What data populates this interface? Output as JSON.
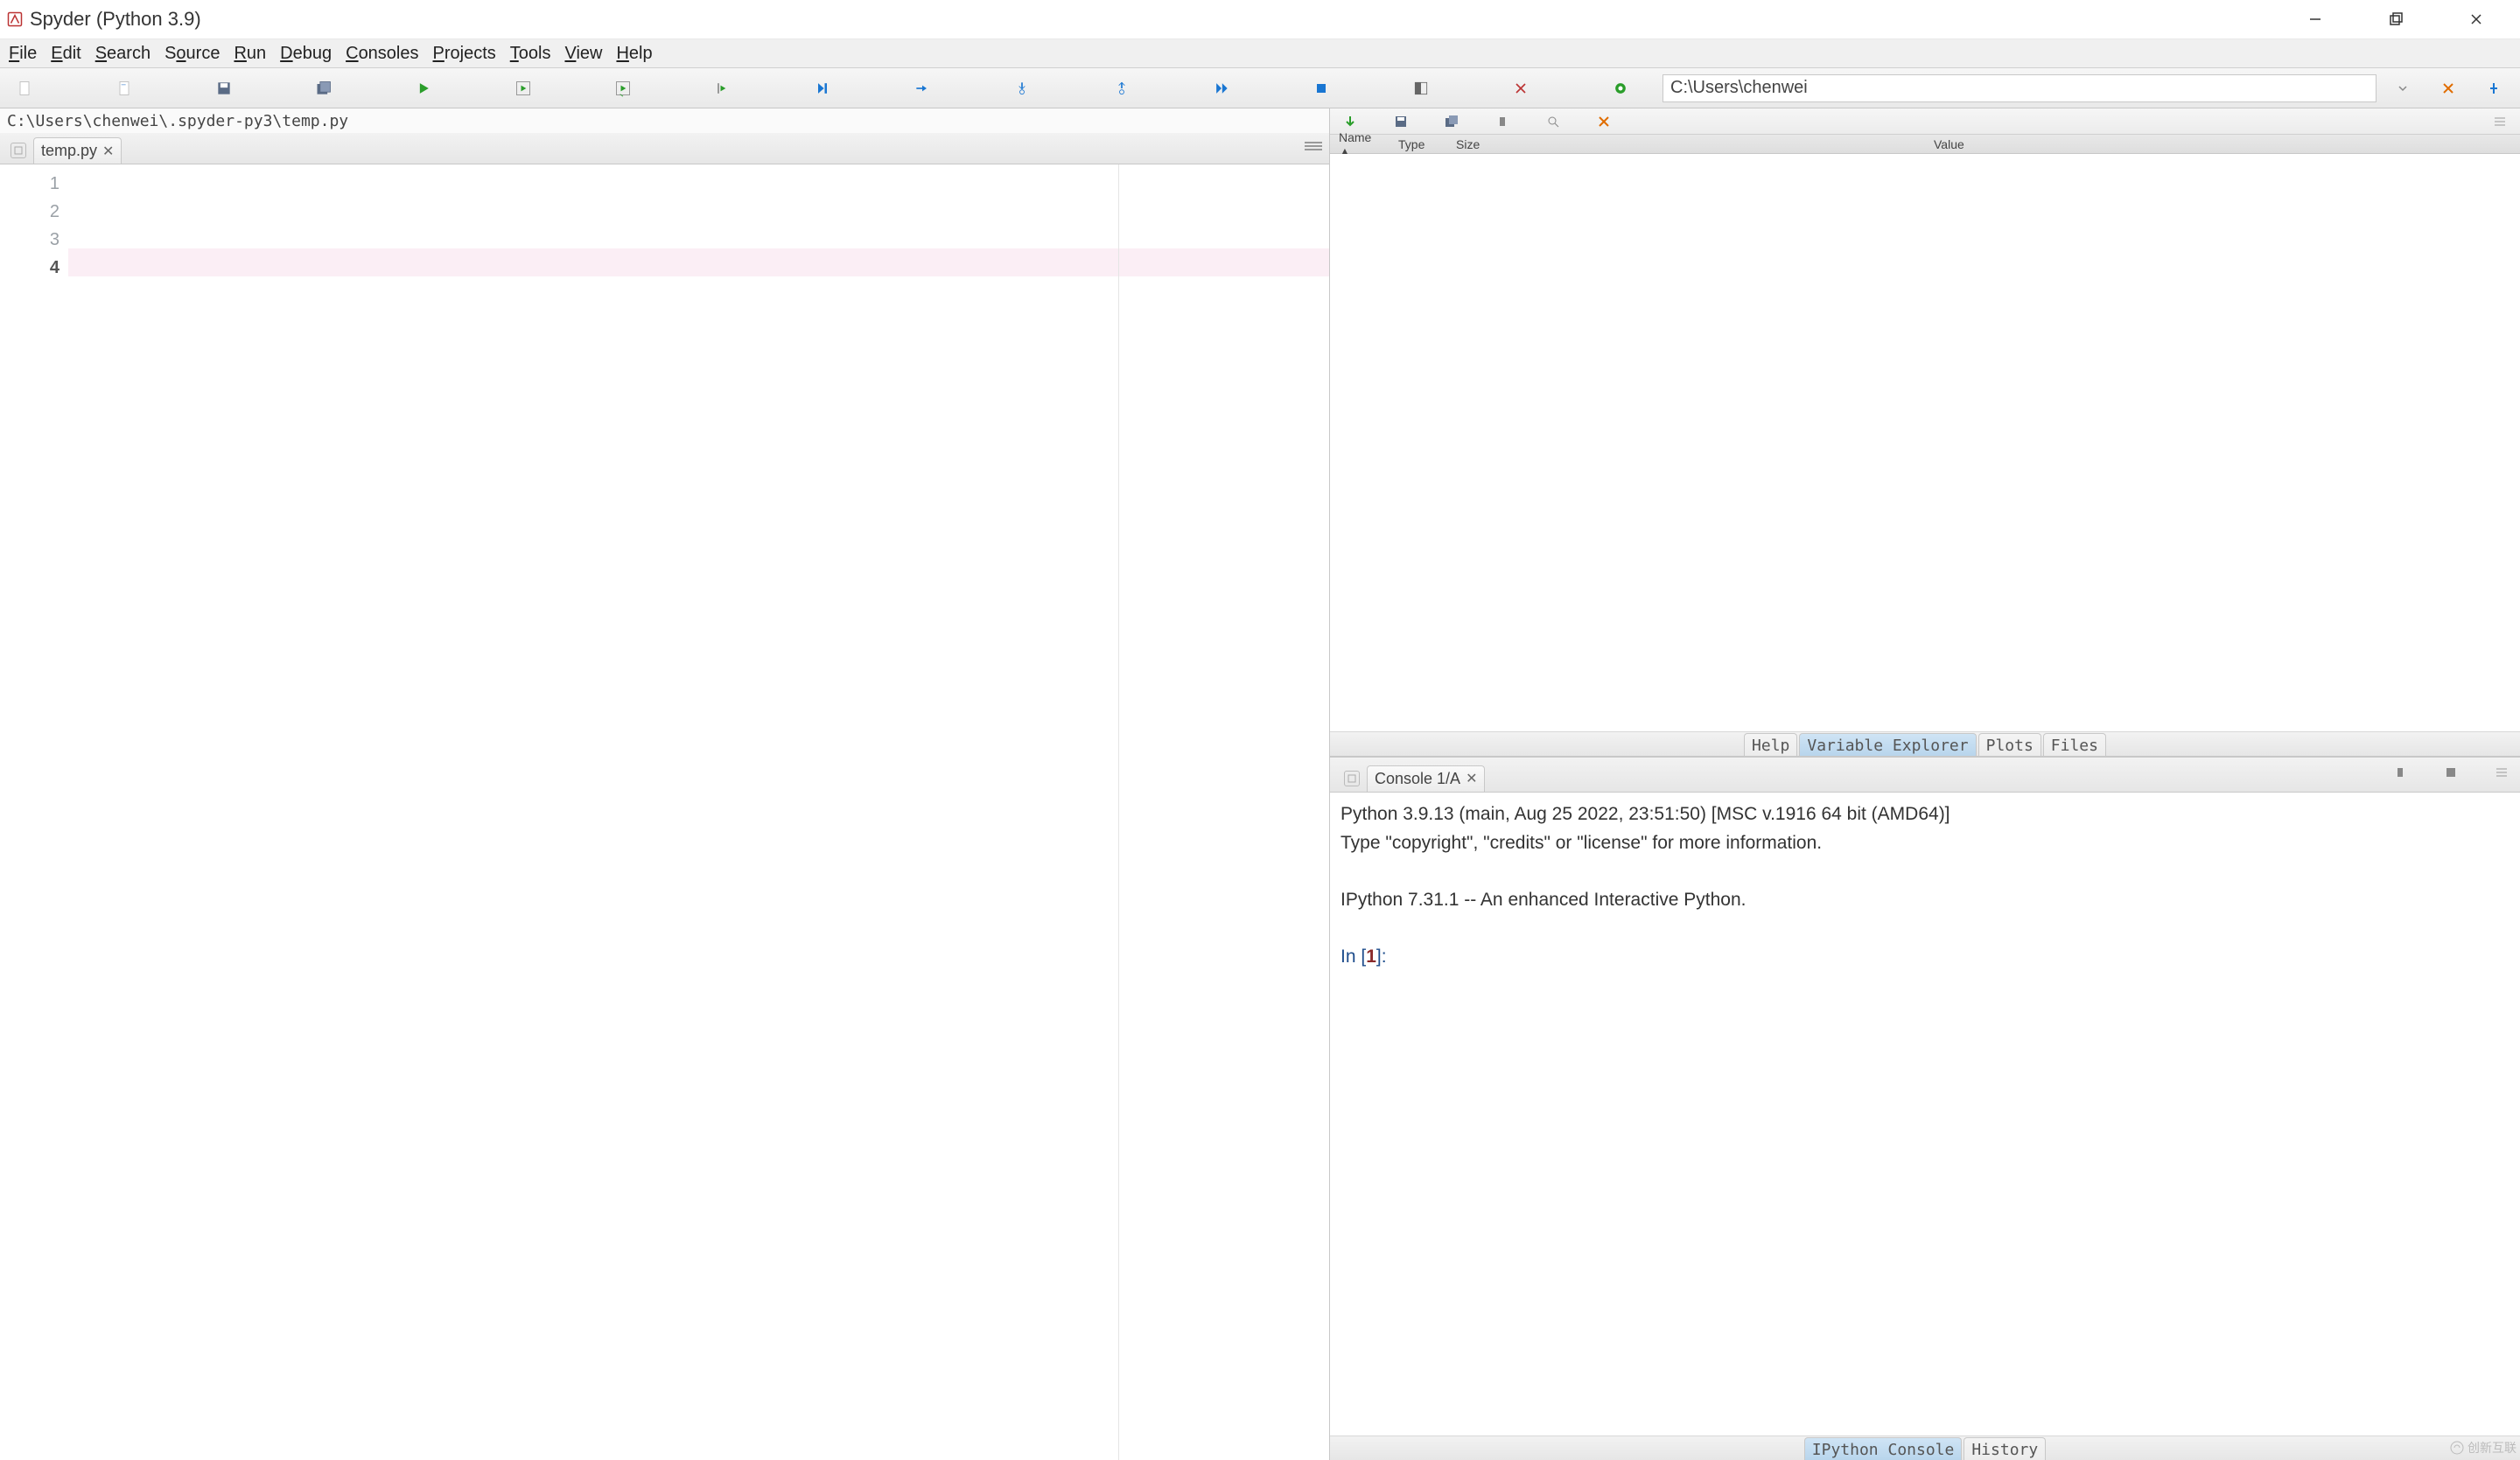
{
  "title": "Spyder (Python 3.9)",
  "menus": [
    "File",
    "Edit",
    "Search",
    "Source",
    "Run",
    "Debug",
    "Consoles",
    "Projects",
    "Tools",
    "View",
    "Help"
  ],
  "cwd": "C:\\Users\\chenwei",
  "editor": {
    "path": "C:\\Users\\chenwei\\.spyder-py3\\temp.py",
    "tab": "temp.py",
    "lines": [
      "1",
      "2",
      "3",
      "4"
    ],
    "current_line": 4
  },
  "var_explorer": {
    "columns": {
      "name": "Name",
      "type": "Type",
      "size": "Size",
      "value": "Value"
    }
  },
  "right_tabs": {
    "help": "Help",
    "var": "Variable Explorer",
    "plots": "Plots",
    "files": "Files"
  },
  "console": {
    "tab": "Console 1/A",
    "line1": "Python 3.9.13 (main, Aug 25 2022, 23:51:50) [MSC v.1916 64 bit (AMD64)]",
    "line2": "Type \"copyright\", \"credits\" or \"license\" for more information.",
    "line3": "IPython 7.31.1 -- An enhanced Interactive Python.",
    "prompt_pre": "In [",
    "prompt_num": "1",
    "prompt_post": "]: "
  },
  "bottom_tabs": {
    "ipy": "IPython Console",
    "hist": "History"
  },
  "watermark": "创新互联"
}
